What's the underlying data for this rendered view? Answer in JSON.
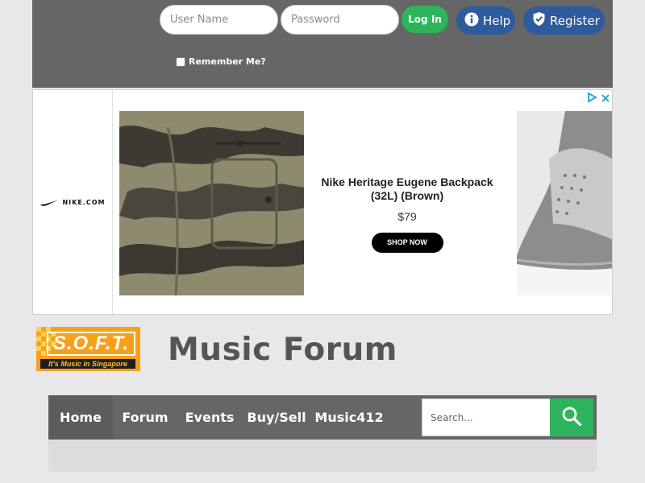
{
  "login": {
    "username_placeholder": "User Name",
    "password_placeholder": "Password",
    "login_label": "Log In",
    "help_label": "Help",
    "register_label": "Register",
    "remember_label": "Remember Me?"
  },
  "ad": {
    "brand": "NIKE.COM",
    "product_title": "Nike Heritage Eugene Backpack (32L) (Brown)",
    "price": "$79",
    "cta": "SHOP NOW"
  },
  "logo": {
    "name": "S.O.F.T.",
    "tagline": "It's Music in Singapore"
  },
  "site_title": "Music Forum",
  "nav": {
    "items": [
      {
        "label": "Home"
      },
      {
        "label": "Forum"
      },
      {
        "label": "Events"
      },
      {
        "label": "Buy/Sell"
      },
      {
        "label": "Music412"
      }
    ],
    "active": "Home",
    "search_placeholder": "Search..."
  },
  "colors": {
    "header_bg": "#666666",
    "accent_green": "#2db55d",
    "button_blue": "#2e5a9e",
    "logo_orange": "#f7a11a",
    "caret_blue": "#1e90ff"
  },
  "icons": {
    "help": "info-icon",
    "register": "shield-check-icon",
    "search": "search-icon",
    "adchoices": "adchoices-icon",
    "ad_close": "close-icon",
    "brand": "nike-swoosh-icon"
  }
}
